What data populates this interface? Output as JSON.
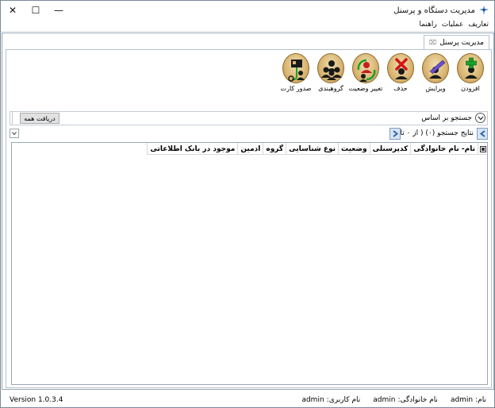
{
  "window": {
    "title": "مدیریت دستگاه و پرسنل",
    "close_glyph": "✕",
    "max_glyph": "☐",
    "min_glyph": "—"
  },
  "menu": [
    "تعاریف",
    "عملیات",
    "راهنما"
  ],
  "tab": {
    "label": "مدیریت پرسنل",
    "close_glyph": "⌧"
  },
  "toolbar": [
    {
      "name": "add",
      "label": "افزودن",
      "icon": "person-add-icon"
    },
    {
      "name": "edit",
      "label": "ویرایش",
      "icon": "person-edit-icon"
    },
    {
      "name": "delete",
      "label": "حذف",
      "icon": "person-delete-icon"
    },
    {
      "name": "change-status",
      "label": "تغییر وضعیت",
      "icon": "person-status-icon"
    },
    {
      "name": "grouping",
      "label": "گروهبندی",
      "icon": "group-icon"
    },
    {
      "name": "issue-card",
      "label": "صدور کارت",
      "icon": "card-issue-icon"
    }
  ],
  "search": {
    "label": "جستجو بر اساس",
    "fetch_all_label": "دریافت همه"
  },
  "results": {
    "text": "نتایج جستجو (۰) ( از ۰ تا ۰ )"
  },
  "grid": {
    "columns": [
      "نام- نام خانوادگی",
      "کدپرسنلی",
      "وضعیت",
      "نوع شناسایی",
      "گروه",
      "ادمین",
      "موجود در بانک اطلاعاتی"
    ],
    "rows": []
  },
  "status": {
    "version": "Version 1.0.3.4",
    "items": [
      {
        "label": "نام:",
        "value": "admin"
      },
      {
        "label": "نام خانوادگی:",
        "value": "admin"
      },
      {
        "label": "نام کاربری:",
        "value": "admin"
      }
    ]
  },
  "colors": {
    "accent_blue": "#2f66a8",
    "icon_gold": "#d9b571",
    "border": "#9aa6b3"
  }
}
